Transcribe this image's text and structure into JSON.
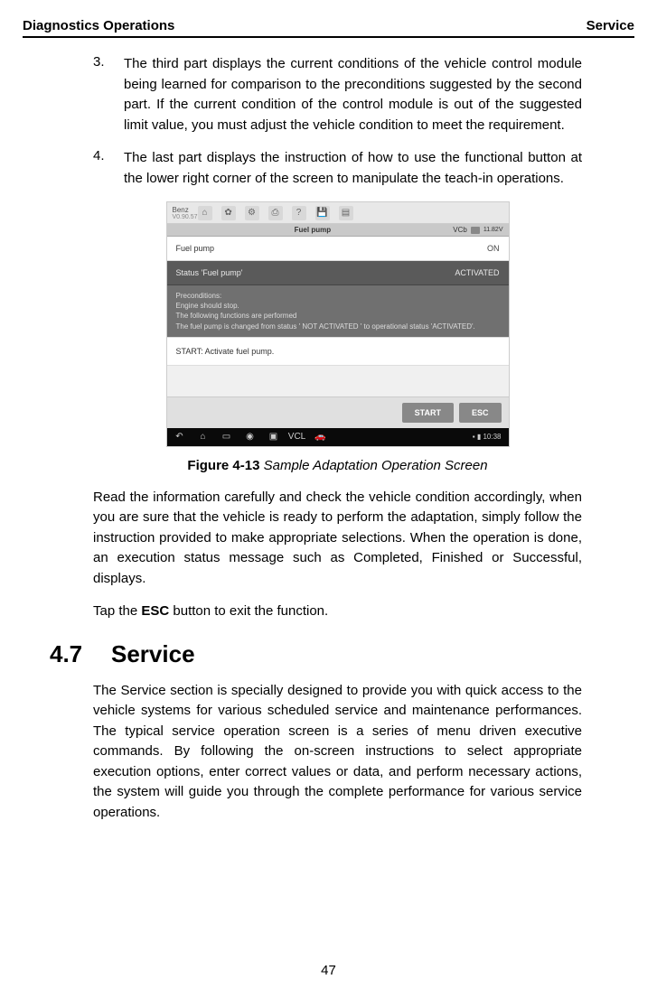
{
  "header": {
    "left": "Diagnostics Operations",
    "right": "Service"
  },
  "items": [
    {
      "num": "3.",
      "text": "The third part displays the current conditions of the vehicle control module being learned for comparison to the preconditions suggested by the second part. If the current condition of the control module is out of the suggested limit value, you must adjust the vehicle condition to meet the requirement."
    },
    {
      "num": "4.",
      "text": "The last part displays the instruction of how to use the functional button at the lower right corner of the screen to manipulate the teach-in operations."
    }
  ],
  "screenshot": {
    "brand": "Benz",
    "brand_sub": "V0.90.57",
    "title_center": "Fuel pump",
    "vci_label": "VCb",
    "battery": "11.82V",
    "row1_label": "Fuel pump",
    "row1_val": "ON",
    "row2_label": "Status 'Fuel pump'",
    "row2_val": "ACTIVATED",
    "pre_title": "Preconditions:",
    "pre_line1": "Engine should stop.",
    "pre_line2": "The following functions are performed",
    "pre_line3": "The fuel pump is changed from status ' NOT ACTIVATED ' to operational status 'ACTIVATED'.",
    "instr": "START: Activate fuel pump.",
    "btn_start": "START",
    "btn_esc": "ESC",
    "nav_vcl": "VCL",
    "time": "10:38"
  },
  "figure": {
    "bold": "Figure 4-13",
    "italic": " Sample Adaptation Operation Screen"
  },
  "para1": "Read the information carefully and check the vehicle condition accordingly, when you are sure that the vehicle is ready to perform the adaptation, simply follow the instruction provided to make appropriate selections. When the operation is done, an execution status message such as Completed, Finished or Successful, displays.",
  "para2_pre": "Tap the ",
  "para2_bold": "ESC",
  "para2_post": " button to exit the function.",
  "section": {
    "num": "4.7",
    "title": "Service"
  },
  "para3": "The Service section is specially designed to provide you with quick access to the vehicle systems for various scheduled service and maintenance performances. The typical service operation screen is a series of menu driven executive commands. By following the on-screen instructions to select appropriate execution options, enter correct values or data, and perform necessary actions, the system will guide you through the complete performance for various service operations.",
  "page_num": "47"
}
